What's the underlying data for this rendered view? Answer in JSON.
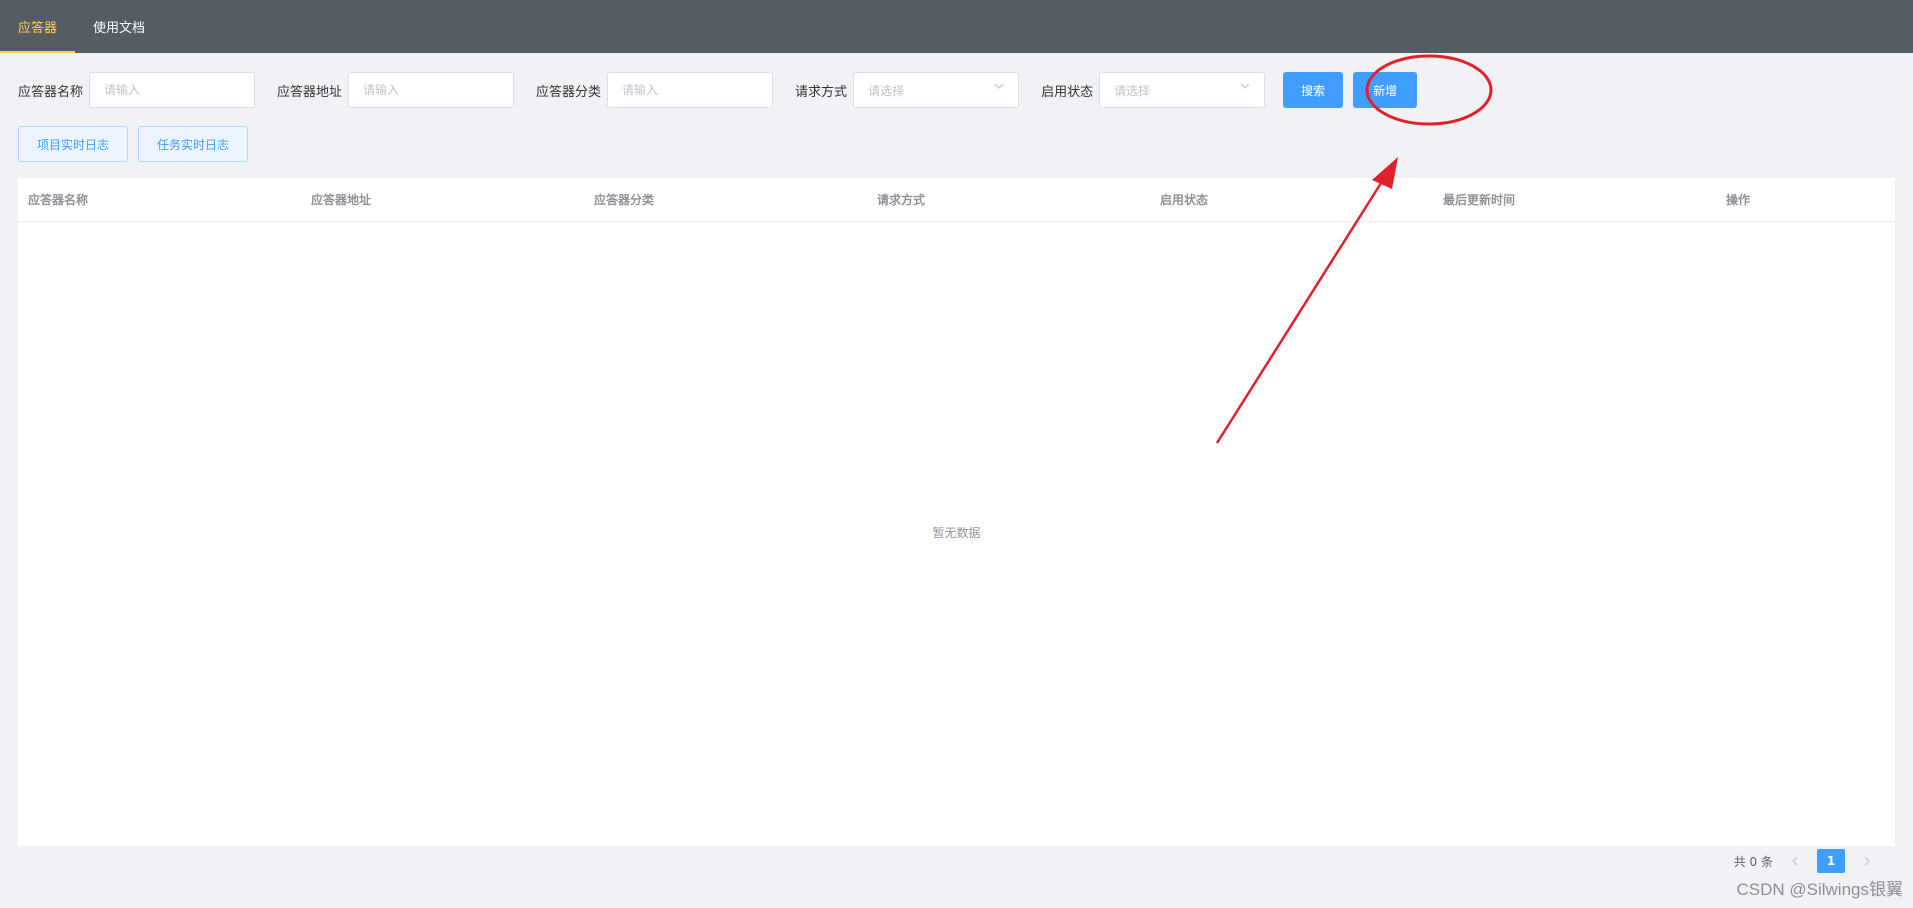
{
  "nav": {
    "tabs": [
      {
        "label": "应答器",
        "active": true
      },
      {
        "label": "使用文档",
        "active": false
      }
    ]
  },
  "filters": {
    "name": {
      "label": "应答器名称",
      "placeholder": "请输入"
    },
    "address": {
      "label": "应答器地址",
      "placeholder": "请输入"
    },
    "category": {
      "label": "应答器分类",
      "placeholder": "请输入"
    },
    "method": {
      "label": "请求方式",
      "placeholder": "请选择"
    },
    "status": {
      "label": "启用状态",
      "placeholder": "请选择"
    },
    "search_label": "搜索",
    "add_label": "新增"
  },
  "actions": {
    "project_log": "项目实时日志",
    "task_log": "任务实时日志"
  },
  "table": {
    "columns": [
      "应答器名称",
      "应答器地址",
      "应答器分类",
      "请求方式",
      "启用状态",
      "最后更新时间",
      "操作"
    ],
    "empty_text": "暂无数据"
  },
  "pagination": {
    "total": "共 0 条",
    "current_page": "1"
  },
  "watermark": "CSDN @Silwings银翼",
  "colors": {
    "nav_bg": "#545c64",
    "nav_active": "#ffd04b",
    "primary": "#409eff",
    "annotation": "#e3202a"
  }
}
